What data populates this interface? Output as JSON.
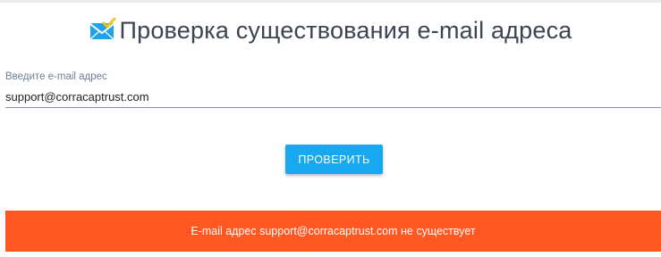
{
  "header": {
    "title": "Проверка существования e-mail адреса",
    "icon": "envelope-check-icon"
  },
  "form": {
    "email_label": "Введите e-mail адрес",
    "email_value": "support@corracaptrust.com",
    "check_button_label": "ПРОВЕРИТЬ"
  },
  "result": {
    "message": "E-mail адрес support@corracaptrust.com не существует",
    "status_color": "#ff5722"
  },
  "colors": {
    "accent": "#17a8f0",
    "title_text": "#3c4452",
    "label_text": "#6f7f95"
  }
}
